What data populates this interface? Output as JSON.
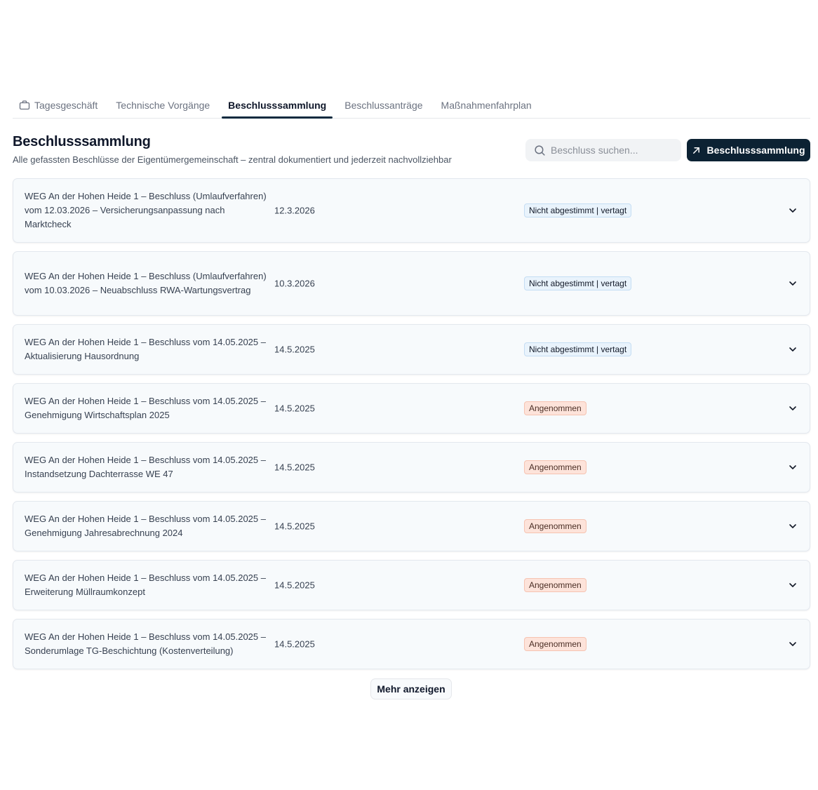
{
  "tabs": [
    {
      "label": "Tagesgeschäft",
      "icon": "briefcase-icon",
      "active": false
    },
    {
      "label": "Technische Vorgänge",
      "active": false
    },
    {
      "label": "Beschlusssammlung",
      "active": true
    },
    {
      "label": "Beschlussanträge",
      "active": false
    },
    {
      "label": "Maßnahmenfahrplan",
      "active": false
    }
  ],
  "header": {
    "title": "Beschlusssammlung",
    "subtitle": "Alle gefassten Beschlüsse der Eigentümergemeinschaft – zentral dokumentiert und jederzeit nachvollziehbar"
  },
  "search": {
    "placeholder": "Beschluss suchen...",
    "value": "",
    "icon": "search-icon"
  },
  "primary_button": {
    "label": "Beschlusssammlung",
    "icon": "arrow-up-right-icon",
    "color": "#0c2233"
  },
  "status_colors": {
    "pending": "#e9f3fc",
    "accepted": "#fde3da"
  },
  "rows": [
    {
      "title": "WEG An der Hohen Heide 1 – Beschluss (Umlaufverfahren) vom 12.03.2026 – Versicherungsanpassung nach Marktcheck",
      "date": "12.3.2026",
      "status": "Nicht abgestimmt | vertagt",
      "status_type": "pending"
    },
    {
      "title": "WEG An der Hohen Heide 1 – Beschluss (Umlaufverfahren) vom 10.03.2026 – Neuabschluss RWA-Wartungsvertrag",
      "date": "10.3.2026",
      "status": "Nicht abgestimmt | vertagt",
      "status_type": "pending"
    },
    {
      "title": "WEG An der Hohen Heide 1 – Beschluss vom 14.05.2025 – Aktualisierung Hausordnung",
      "date": "14.5.2025",
      "status": "Nicht abgestimmt | vertagt",
      "status_type": "pending"
    },
    {
      "title": "WEG An der Hohen Heide 1 – Beschluss vom 14.05.2025 – Genehmigung Wirtschaftsplan 2025",
      "date": "14.5.2025",
      "status": "Angenommen",
      "status_type": "accepted"
    },
    {
      "title": "WEG An der Hohen Heide 1 – Beschluss vom 14.05.2025 – Instandsetzung Dachterrasse WE 47",
      "date": "14.5.2025",
      "status": "Angenommen",
      "status_type": "accepted"
    },
    {
      "title": "WEG An der Hohen Heide 1 – Beschluss vom 14.05.2025 – Genehmigung Jahresabrechnung 2024",
      "date": "14.5.2025",
      "status": "Angenommen",
      "status_type": "accepted"
    },
    {
      "title": "WEG An der Hohen Heide 1 – Beschluss vom 14.05.2025 – Erweiterung Müllraumkonzept",
      "date": "14.5.2025",
      "status": "Angenommen",
      "status_type": "accepted"
    },
    {
      "title": "WEG An der Hohen Heide 1 – Beschluss vom 14.05.2025 – Sonderumlage TG-Beschichtung (Kostenverteilung)",
      "date": "14.5.2025",
      "status": "Angenommen",
      "status_type": "accepted"
    }
  ],
  "more_button": {
    "label": "Mehr anzeigen"
  }
}
